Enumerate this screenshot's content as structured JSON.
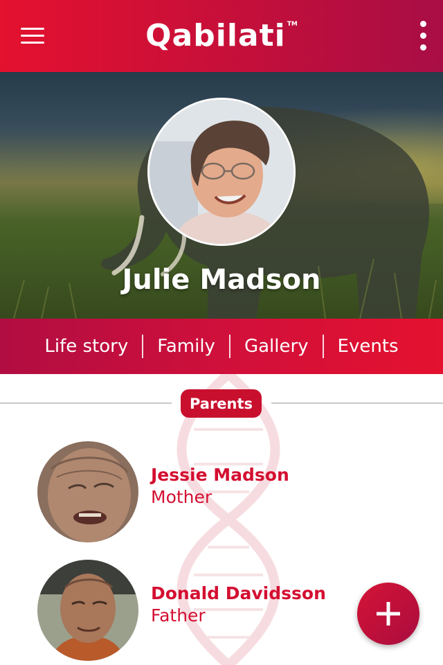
{
  "app_bar": {
    "logo_text": "Qabilati",
    "trademark": "TM",
    "menu_icon": "hamburger-menu-icon",
    "overflow_icon": "more-vertical-icon"
  },
  "profile": {
    "name": "Julie Madson"
  },
  "tabs": [
    {
      "label": "Life story"
    },
    {
      "label": "Family"
    },
    {
      "label": "Gallery"
    },
    {
      "label": "Events"
    }
  ],
  "section": {
    "title": "Parents"
  },
  "parents": [
    {
      "name": "Jessie Madson",
      "relation": "Mother"
    },
    {
      "name": "Donald Davidsson",
      "relation": "Father"
    }
  ],
  "fab": {
    "icon": "plus-icon"
  },
  "colors": {
    "brand_red": "#e4112f",
    "brand_crimson": "#a80e45",
    "text_red": "#d40f31"
  }
}
